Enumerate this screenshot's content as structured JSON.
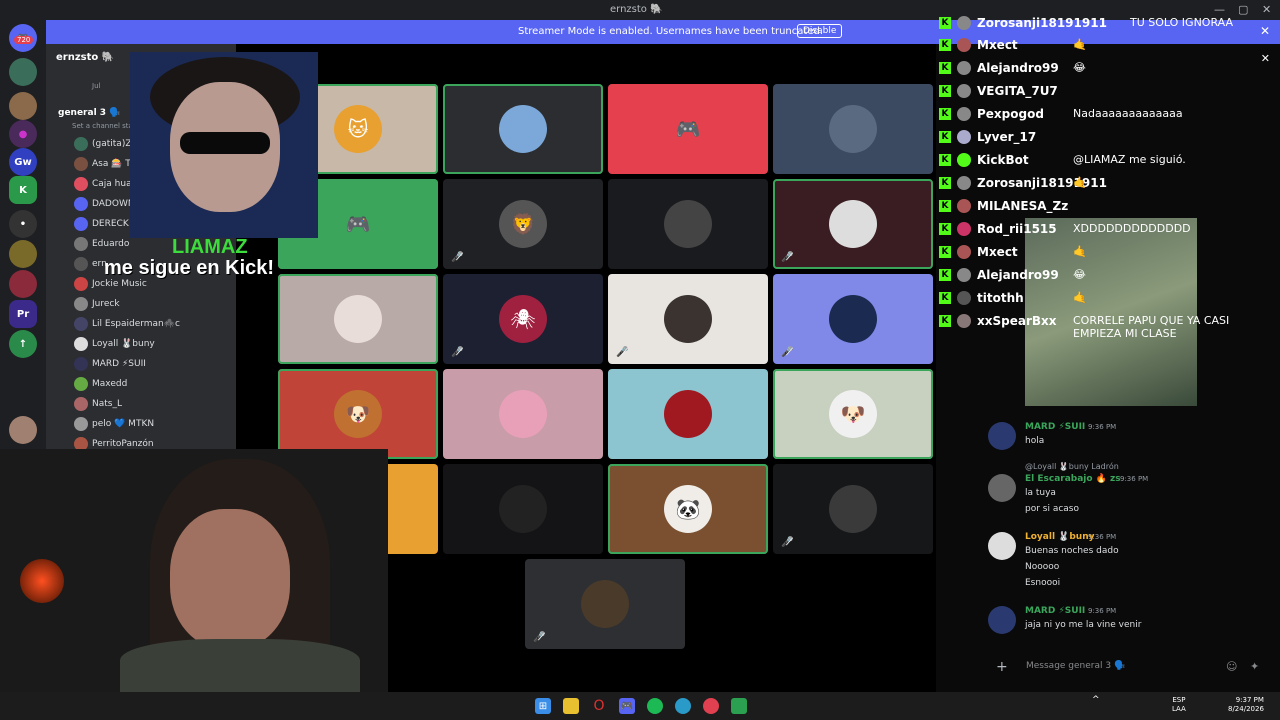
{
  "window": {
    "title": "ernzsto 🐘",
    "controls": [
      "—",
      "▢",
      "✕"
    ]
  },
  "banner": {
    "text": "Streamer Mode is enabled. Usernames have been truncated.",
    "button": "Disable"
  },
  "rail": {
    "badge": "720"
  },
  "sidebar": {
    "server_name": "ernzsto 🐘",
    "channel_name": "general 3 🗣️",
    "channel_sub": "Set a channel status",
    "top_item": "Jul",
    "members": [
      {
        "name": "(gatita)Zo",
        "color": "#3a6e5a"
      },
      {
        "name": "Asa 🎰 TIL",
        "color": "#7a5040"
      },
      {
        "name": "Caja huanc",
        "color": "#e04f5f"
      },
      {
        "name": "DADOWN",
        "color": "#5865f2"
      },
      {
        "name": "DERECK",
        "color": "#5865f2"
      },
      {
        "name": "Eduardo",
        "color": "#777"
      },
      {
        "name": "ern",
        "color": "#555"
      },
      {
        "name": "Jockie Music",
        "color": "#c44"
      },
      {
        "name": "Jureck",
        "color": "#888"
      },
      {
        "name": "Lil Espaiderman🕷️c",
        "color": "#446"
      },
      {
        "name": "Loyall 🐰buny",
        "color": "#ddd"
      },
      {
        "name": "MARD ⚡SUII",
        "color": "#335"
      },
      {
        "name": "Maxedd",
        "color": "#6a4"
      },
      {
        "name": "Nats_L",
        "color": "#a66"
      },
      {
        "name": "pelo 💙 MTKN",
        "color": "#999"
      },
      {
        "name": "PerritoPanzón",
        "color": "#a54"
      }
    ]
  },
  "overlay": {
    "name": "LIAMAZ",
    "message": "me sigue en Kick!"
  },
  "grid_tiles": [
    {
      "bg": "#c8b8a8",
      "avatar": "#e8a030",
      "glyph": "🐱",
      "speaking": true,
      "muted": false
    },
    {
      "bg": "#2b2d31",
      "avatar": "#7ba8d8",
      "glyph": "",
      "speaking": true,
      "muted": false
    },
    {
      "bg": "#e5404e",
      "avatar": "#e5404e",
      "glyph": "🎮",
      "speaking": false,
      "muted": false
    },
    {
      "bg": "#3b4a60",
      "avatar": "#5a6a80",
      "glyph": "",
      "speaking": false,
      "muted": false
    },
    {
      "bg": "#3ba55c",
      "avatar": "#3ba55c",
      "glyph": "🎮",
      "speaking": true,
      "muted": false
    },
    {
      "bg": "#1f2124",
      "avatar": "#555",
      "glyph": "🦁",
      "speaking": false,
      "muted": true
    },
    {
      "bg": "#1a1b1e",
      "avatar": "#444",
      "glyph": "",
      "speaking": false,
      "muted": false
    },
    {
      "bg": "#3a1d22",
      "avatar": "#ddd",
      "glyph": "",
      "speaking": true,
      "muted": true
    },
    {
      "bg": "#b8aaa6",
      "avatar": "#e8ddd8",
      "glyph": "",
      "speaking": true,
      "muted": false
    },
    {
      "bg": "#1c2030",
      "avatar": "#a02040",
      "glyph": "🕷",
      "speaking": false,
      "muted": true
    },
    {
      "bg": "#e8e4e0",
      "avatar": "#3a3330",
      "glyph": "",
      "speaking": false,
      "muted": true
    },
    {
      "bg": "#8088e8",
      "avatar": "#1a2a50",
      "glyph": "",
      "speaking": false,
      "muted": true
    },
    {
      "bg": "#c04438",
      "avatar": "#c07030",
      "glyph": "🐶",
      "speaking": true,
      "muted": false
    },
    {
      "bg": "#c89ca8",
      "avatar": "#e8a0b8",
      "glyph": "",
      "speaking": false,
      "muted": false
    },
    {
      "bg": "#8cc4d0",
      "avatar": "#a01820",
      "glyph": "",
      "speaking": false,
      "muted": false
    },
    {
      "bg": "#c8d0c0",
      "avatar": "#f0f0f0",
      "glyph": "🐶",
      "speaking": true,
      "muted": false
    },
    {
      "bg": "#e8a030",
      "avatar": "#e8a030",
      "glyph": "",
      "speaking": false,
      "muted": false
    },
    {
      "bg": "#141416",
      "avatar": "#222",
      "glyph": "",
      "speaking": false,
      "muted": false
    },
    {
      "bg": "#7a5030",
      "avatar": "#f0ece8",
      "glyph": "🐼",
      "speaking": true,
      "muted": false
    },
    {
      "bg": "#161719",
      "avatar": "#3a3a3a",
      "glyph": "",
      "speaking": false,
      "muted": true
    },
    {
      "bg": "#2e2f33",
      "avatar": "#4a3a2a",
      "glyph": "",
      "speaking": false,
      "muted": true
    }
  ],
  "kick_chat": [
    {
      "user": "Zorosanji18191911",
      "msg": "TU SOLO IGNORAA",
      "color": "#888"
    },
    {
      "user": "Mxect",
      "msg": "🤙",
      "color": "#a55"
    },
    {
      "user": "Alejandro99",
      "msg": "😂",
      "color": "#888"
    },
    {
      "user": "VEGITA_7U7",
      "msg": "",
      "color": "#888"
    },
    {
      "user": "Pexpogod",
      "msg": "Nadaaaaaaaaaaaaa",
      "color": "#888"
    },
    {
      "user": "Lyver_17",
      "msg": "",
      "color": "#aac"
    },
    {
      "user": "KickBot",
      "msg": "@LIAMAZ me siguió.",
      "color": "#53fc18"
    },
    {
      "user": "Zorosanji18191911",
      "msg": "🤙",
      "color": "#888"
    },
    {
      "user": "MILANESA_Zz",
      "msg": "",
      "color": "#a55"
    },
    {
      "user": "Rod_rii1515",
      "msg": "XDDDDDDDDDDDDD",
      "color": "#c36"
    },
    {
      "user": "Mxect",
      "msg": "🤙",
      "color": "#a55"
    },
    {
      "user": "Alejandro99",
      "msg": "😂",
      "color": "#888"
    },
    {
      "user": "titothh",
      "msg": "🤙",
      "color": "#555"
    },
    {
      "user": "xxSpearBxx",
      "msg": "CORRELE PAPU QUE YA CASI",
      "msg2": "EMPIEZA MI CLASE",
      "color": "#877"
    }
  ],
  "discord_chat": {
    "messages": [
      {
        "name": "MARD ⚡SUII",
        "time": "9:36 PM",
        "lines": [
          "hola"
        ],
        "color": "#3ba55c",
        "avatar": "#2a3a70",
        "reply": ""
      },
      {
        "name": "El Escarabajo 🔥 zs",
        "time": "9:36 PM",
        "lines": [
          "la tuya",
          "por si acaso"
        ],
        "color": "#3ba55c",
        "avatar": "#666",
        "reply": "@Loyall 🐰buny Ladrón"
      },
      {
        "name": "Loyall 🐰buny",
        "time": "9:36 PM",
        "lines": [
          "Buenas noches dado",
          "Nooooo",
          "Esnoooi"
        ],
        "color": "#f0b232",
        "avatar": "#ddd",
        "reply": ""
      },
      {
        "name": "MARD ⚡SUII",
        "time": "9:36 PM",
        "lines": [
          "jaja ni yo me la vine venir"
        ],
        "color": "#3ba55c",
        "avatar": "#2a3a70",
        "reply": ""
      }
    ],
    "input_placeholder": "Message general 3 🗣️"
  },
  "taskbar": {
    "lang": "ESP",
    "region": "LAA",
    "time": "9:37 PM",
    "date": "8/24/2026"
  }
}
